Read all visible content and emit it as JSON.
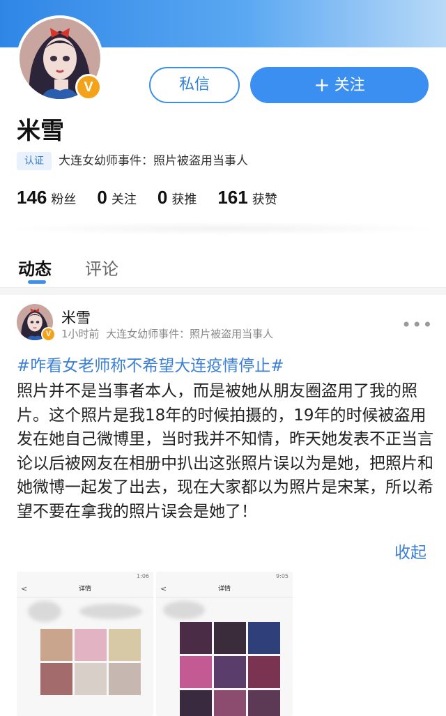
{
  "profile": {
    "name": "米雪",
    "verify_tag": "认证",
    "verify_text": "大连女幼师事件：照片被盗用当事人",
    "badge": "V",
    "stats": [
      {
        "num": "146",
        "label": "粉丝"
      },
      {
        "num": "0",
        "label": "关注"
      },
      {
        "num": "0",
        "label": "获推"
      },
      {
        "num": "161",
        "label": "获赞"
      }
    ]
  },
  "actions": {
    "message_label": "私信",
    "follow_label": "关注",
    "follow_prefix": "+"
  },
  "tabs": [
    {
      "label": "动态",
      "active": true
    },
    {
      "label": "评论",
      "active": false
    }
  ],
  "post": {
    "author": "米雪",
    "time": "1小时前",
    "source": "大连女幼师事件：照片被盗用当事人",
    "more": "•••",
    "topic": "#咋看女老师称不希望大连疫情停止#",
    "body": "照片并不是当事者本人，而是被她从朋友圈盗用了我的照片。这个照片是我18年的时候拍摄的，19年的时候被盗用发在她自己微博里，当时我并不知情，昨天她发表不正当言论以后被网友在相册中扒出这张照片误以为是她，把照片和她微博一起发了出去，现在大家都以为照片是宋某，所以希望不要在拿我的照片误会是她了！",
    "collapse": "收起",
    "images": [
      {
        "title": "详情",
        "time": "1:06",
        "back": "<"
      },
      {
        "title": "详情",
        "time": "9:05",
        "back": "<"
      }
    ]
  },
  "colors": {
    "accent": "#3b8ff0",
    "link": "#3a7fd5",
    "badge": "#f4a21a"
  },
  "icons": [
    "vip-badge-icon",
    "plus-icon",
    "more-icon",
    "back-arrow-icon"
  ]
}
